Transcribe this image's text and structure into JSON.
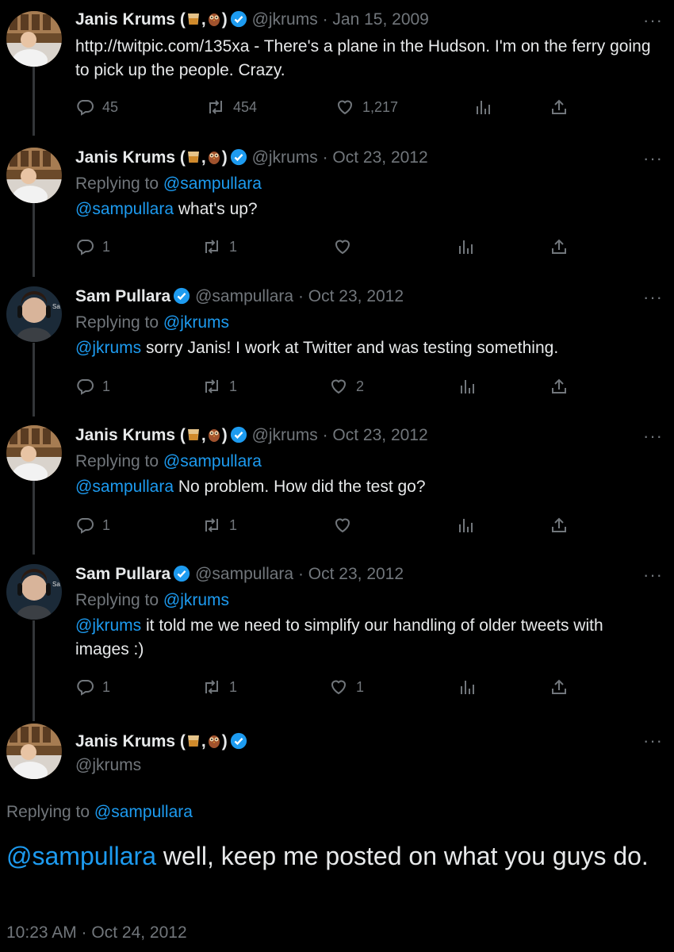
{
  "tweets": [
    {
      "name": "Janis Krums (",
      "name_sep": ",",
      "name_end": ")",
      "handle": "@jkrums",
      "dot": "·",
      "date": "Jan 15, 2009",
      "replying_label": "",
      "replying_to": "",
      "mention": "",
      "text": "http://twitpic.com/135xa - There's a plane in the Hudson. I'm on the ferry going to pick up the people. Crazy.",
      "replies": "45",
      "retweets": "454",
      "likes": "1,217"
    },
    {
      "name": "Janis Krums (",
      "name_sep": ",",
      "name_end": ")",
      "handle": "@jkrums",
      "dot": "·",
      "date": "Oct 23, 2012",
      "replying_label": "Replying to",
      "replying_to": "@sampullara",
      "mention": "@sampullara",
      "text": " what's up?",
      "replies": "1",
      "retweets": "1",
      "likes": ""
    },
    {
      "name": "Sam Pullara",
      "handle": "@sampullara",
      "dot": "·",
      "date": "Oct 23, 2012",
      "replying_label": "Replying to",
      "replying_to": "@jkrums",
      "mention": "@jkrums",
      "text": " sorry Janis! I work at Twitter and was testing something.",
      "replies": "1",
      "retweets": "1",
      "likes": "2"
    },
    {
      "name": "Janis Krums (",
      "name_sep": ",",
      "name_end": ")",
      "handle": "@jkrums",
      "dot": "·",
      "date": "Oct 23, 2012",
      "replying_label": "Replying to",
      "replying_to": "@sampullara",
      "mention": "@sampullara",
      "text": " No problem. How did the test go?",
      "replies": "1",
      "retweets": "1",
      "likes": ""
    },
    {
      "name": "Sam Pullara",
      "handle": "@sampullara",
      "dot": "·",
      "date": "Oct 23, 2012",
      "replying_label": "Replying to",
      "replying_to": "@jkrums",
      "mention": "@jkrums",
      "text": " it told me we need to simplify our handling of older tweets with images :)",
      "replies": "1",
      "retweets": "1",
      "likes": "1"
    }
  ],
  "focused": {
    "name": "Janis Krums (",
    "name_sep": ",",
    "name_end": ")",
    "handle": "@jkrums",
    "replying_label": "Replying to",
    "replying_to": "@sampullara",
    "mention": "@sampullara",
    "text": " well, keep me posted on what you guys do.",
    "timestamp": "10:23 AM · Oct 24, 2012"
  },
  "more_label": "···",
  "colors": {
    "background": "#000000",
    "text": "#e7e9ea",
    "muted": "#71767b",
    "accent": "#1d9bf0",
    "thread_line": "#333639"
  },
  "icons": [
    "reply-icon",
    "retweet-icon",
    "like-icon",
    "views-icon",
    "share-icon",
    "verified-badge-icon",
    "whiskey-glass-icon",
    "owl-icon",
    "more-options-icon"
  ]
}
